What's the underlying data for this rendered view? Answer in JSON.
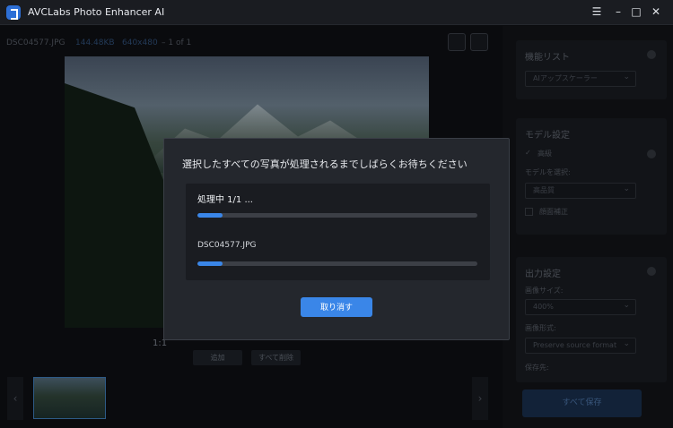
{
  "window": {
    "title": "AVCLabs Photo Enhancer AI",
    "controls": {
      "menu": "☰",
      "minimize": "–",
      "maximize": "□",
      "close": "✕"
    }
  },
  "file_info": {
    "filename": "DSC04577.JPG",
    "size": "144.48KB",
    "dimensions": "640x480",
    "page_count": "1 of 1"
  },
  "preview": {
    "zoom_label": "1:1"
  },
  "bottom_actions": {
    "add_label": "追加",
    "clear_all_label": "すべて削除"
  },
  "thumbnails": {
    "prev_icon": "‹",
    "next_icon": "›"
  },
  "sidebar": {
    "feature_list": {
      "title": "機能リスト",
      "selected": "AIアップスケーラー"
    },
    "model_settings": {
      "title": "モデル設定",
      "mode": "高級",
      "select_model_label": "モデルを選択:",
      "model_selected": "高品質",
      "face_correction_label": "顔面補正"
    },
    "output_settings": {
      "title": "出力設定",
      "image_size_label": "画像サイズ:",
      "image_size_selected": "400%",
      "image_format_label": "画像形式:",
      "image_format_selected": "Preserve source format",
      "save_to_label": "保存先:"
    },
    "save_all_label": "すべて保存"
  },
  "dialog": {
    "title": "選択したすべての写真が処理されるまでしばらくお待ちください",
    "progress_label": "処理中 1/1 ...",
    "overall_progress": 0.09,
    "current_file": "DSC04577.JPG",
    "file_progress": 0.09,
    "cancel_label": "取り消す"
  },
  "colors": {
    "accent": "#3a86e8",
    "dialog_bg": "#24272d",
    "app_bg": "#0b0c0f"
  }
}
